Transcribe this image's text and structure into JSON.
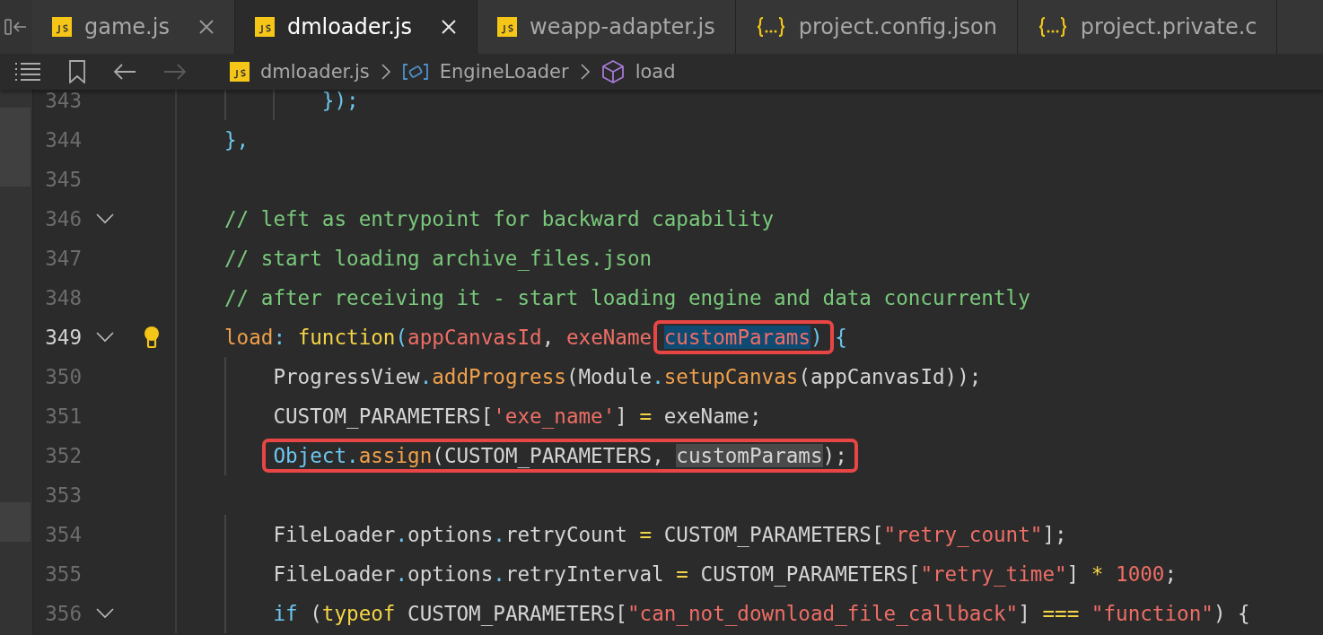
{
  "tabs": [
    {
      "label": "game.js",
      "kind": "script",
      "closable": true,
      "selected": false
    },
    {
      "label": "dmloader.js",
      "kind": "script",
      "closable": true,
      "selected": true
    },
    {
      "label": "weapp-adapter.js",
      "kind": "script",
      "closable": false,
      "selected": false
    },
    {
      "label": "project.config.json",
      "kind": "json",
      "closable": false,
      "selected": false
    },
    {
      "label": "project.private.c",
      "kind": "json",
      "closable": false,
      "selected": false
    }
  ],
  "breadcrumb": {
    "forward_disabled": true,
    "items": [
      {
        "label": "dmloader.js",
        "kind": "file"
      },
      {
        "label": "EngineLoader",
        "kind": "class"
      },
      {
        "label": "load",
        "kind": "method"
      }
    ]
  },
  "editor": {
    "lines": [
      {
        "number": "343",
        "foldable": false,
        "lightbulb": false,
        "current": false,
        "tokens": [
          {
            "text": "        });",
            "kind": "punct"
          }
        ]
      },
      {
        "number": "344",
        "foldable": false,
        "lightbulb": false,
        "current": false,
        "tokens": [
          {
            "text": "},",
            "kind": "punct"
          }
        ]
      },
      {
        "number": "345",
        "foldable": false,
        "lightbulb": false,
        "current": false
      },
      {
        "number": "346",
        "foldable": true,
        "lightbulb": false,
        "current": false,
        "tokens": [
          {
            "text": "// left as entrypoint for backward capability",
            "kind": "comment"
          }
        ]
      },
      {
        "number": "347",
        "foldable": false,
        "lightbulb": false,
        "current": false,
        "tokens": [
          {
            "text": "// start loading archive_files.json",
            "kind": "comment"
          }
        ]
      },
      {
        "number": "348",
        "foldable": false,
        "lightbulb": false,
        "current": false,
        "tokens": [
          {
            "text": "// after receiving it - start loading engine and data concurrently",
            "kind": "comment"
          }
        ]
      },
      {
        "number": "349",
        "foldable": true,
        "lightbulb": true,
        "current": true,
        "tokens": [
          {
            "text": "load",
            "kind": "prop"
          },
          {
            "text": ": ",
            "kind": "punct"
          },
          {
            "text": "function",
            "kind": "keyword"
          },
          {
            "text": "(",
            "kind": "punct"
          },
          {
            "text": "appCanvasId",
            "kind": "param"
          },
          {
            "text": ", ",
            "kind": "plain"
          },
          {
            "text": "exeName ",
            "kind": "param"
          },
          {
            "kind": "group",
            "outlined": true,
            "tokens": [
              {
                "text": "customParams",
                "kind": "param",
                "selected": true
              },
              {
                "text": ")",
                "kind": "punct"
              }
            ]
          },
          {
            "text": " {",
            "kind": "punct"
          }
        ]
      },
      {
        "number": "350",
        "foldable": false,
        "lightbulb": false,
        "current": false,
        "tokens": [
          {
            "text": "    ProgressView",
            "kind": "plain"
          },
          {
            "text": ".",
            "kind": "punct"
          },
          {
            "text": "addProgress",
            "kind": "prop"
          },
          {
            "text": "(Module",
            "kind": "plain"
          },
          {
            "text": ".",
            "kind": "punct"
          },
          {
            "text": "setupCanvas",
            "kind": "prop"
          },
          {
            "text": "(appCanvasId));",
            "kind": "plain"
          }
        ]
      },
      {
        "number": "351",
        "foldable": false,
        "lightbulb": false,
        "current": false,
        "tokens": [
          {
            "text": "    CUSTOM_PARAMETERS[",
            "kind": "plain"
          },
          {
            "text": "'exe_name'",
            "kind": "string"
          },
          {
            "text": "] ",
            "kind": "plain"
          },
          {
            "text": "=",
            "kind": "keyword"
          },
          {
            "text": " exeName;",
            "kind": "plain"
          }
        ]
      },
      {
        "number": "352",
        "foldable": false,
        "lightbulb": false,
        "current": false,
        "tokens": [
          {
            "kind": "group",
            "outlined": true,
            "tokens": [
              {
                "text": "    Object",
                "kind": "punct"
              },
              {
                "text": ".",
                "kind": "punct"
              },
              {
                "text": "assign",
                "kind": "prop"
              },
              {
                "text": "(CUSTOM_PARAMETERS, ",
                "kind": "plain"
              },
              {
                "text": "customParams",
                "kind": "plain",
                "occurrence": true
              },
              {
                "text": ");",
                "kind": "plain"
              }
            ]
          }
        ]
      },
      {
        "number": "353",
        "foldable": false,
        "lightbulb": false,
        "current": false
      },
      {
        "number": "354",
        "foldable": false,
        "lightbulb": false,
        "current": false,
        "tokens": [
          {
            "text": "    FileLoader",
            "kind": "plain"
          },
          {
            "text": ".",
            "kind": "punct"
          },
          {
            "text": "options",
            "kind": "plain"
          },
          {
            "text": ".",
            "kind": "punct"
          },
          {
            "text": "retryCount ",
            "kind": "plain"
          },
          {
            "text": "=",
            "kind": "keyword"
          },
          {
            "text": " CUSTOM_PARAMETERS[",
            "kind": "plain"
          },
          {
            "text": "\"retry_count\"",
            "kind": "string"
          },
          {
            "text": "];",
            "kind": "plain"
          }
        ]
      },
      {
        "number": "355",
        "foldable": false,
        "lightbulb": false,
        "current": false,
        "tokens": [
          {
            "text": "    FileLoader",
            "kind": "plain"
          },
          {
            "text": ".",
            "kind": "punct"
          },
          {
            "text": "options",
            "kind": "plain"
          },
          {
            "text": ".",
            "kind": "punct"
          },
          {
            "text": "retryInterval ",
            "kind": "plain"
          },
          {
            "text": "=",
            "kind": "keyword"
          },
          {
            "text": " CUSTOM_PARAMETERS[",
            "kind": "plain"
          },
          {
            "text": "\"retry_time\"",
            "kind": "string"
          },
          {
            "text": "] ",
            "kind": "plain"
          },
          {
            "text": "*",
            "kind": "keyword"
          },
          {
            "text": " 1000",
            "kind": "string"
          },
          {
            "text": ";",
            "kind": "plain"
          }
        ]
      },
      {
        "number": "356",
        "foldable": true,
        "lightbulb": false,
        "current": false,
        "tokens": [
          {
            "text": "    if",
            "kind": "punct"
          },
          {
            "text": " (",
            "kind": "plain"
          },
          {
            "text": "typeof",
            "kind": "keyword"
          },
          {
            "text": " CUSTOM_PARAMETERS[",
            "kind": "plain"
          },
          {
            "text": "\"can_not_download_file_callback\"",
            "kind": "string"
          },
          {
            "text": "] ",
            "kind": "plain"
          },
          {
            "text": "===",
            "kind": "keyword"
          },
          {
            "text": " \"function\"",
            "kind": "string"
          },
          {
            "text": ") {",
            "kind": "plain"
          }
        ]
      }
    ]
  }
}
